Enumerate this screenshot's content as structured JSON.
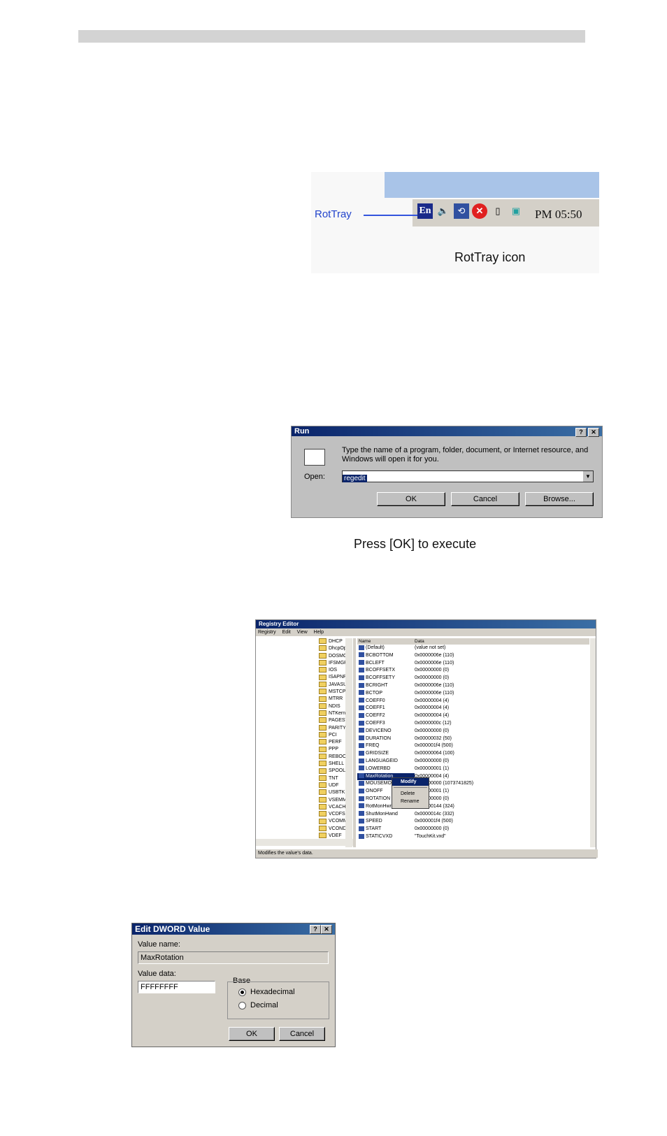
{
  "rottray": {
    "pointer_label": "RotTray",
    "tray_en": "En",
    "clock": "PM 05:50",
    "caption": "RotTray icon",
    "icons": [
      "language-en-icon",
      "speaker-icon",
      "rottray-icon",
      "close-circle-icon",
      "mouse-icon",
      "monitor-icon"
    ]
  },
  "run": {
    "title": "Run",
    "help_btn": "?",
    "close_btn": "✕",
    "prompt": "Type the name of a program, folder, document, or Internet resource, and Windows will open it for you.",
    "open_label": "Open:",
    "open_value": "regedit",
    "ok": "OK",
    "cancel": "Cancel",
    "browse": "Browse...",
    "caption": "Press [OK] to execute"
  },
  "registry": {
    "title": "Registry Editor",
    "menu": [
      "Registry",
      "Edit",
      "View",
      "Help"
    ],
    "tree": [
      "DHCP",
      "DhcpOpt",
      "DOSMGR",
      "IFSMGR",
      "IOS",
      "ISAPNP",
      "JAVASU",
      "MSTCP",
      "MTRR",
      "NDIS",
      "NTKern",
      "PAGESW",
      "PARITY",
      "PCI",
      "PERF",
      "PPP",
      "REBOOT",
      "SHELL",
      "SPOOLE",
      "TNT",
      "UDF",
      "USBTKI",
      "VSEMMG",
      "VCACHE",
      "VCDFSD",
      "VCOMM",
      "VCOND",
      "VDEF"
    ],
    "col_name": "Name",
    "col_data": "Data",
    "rows": [
      {
        "name": "(Default)",
        "data": "(value not set)"
      },
      {
        "name": "BCBOTTOM",
        "data": "0x0000006e (110)"
      },
      {
        "name": "BCLEFT",
        "data": "0x0000006e (110)"
      },
      {
        "name": "BCOFFSETX",
        "data": "0x00000000 (0)"
      },
      {
        "name": "BCOFFSETY",
        "data": "0x00000000 (0)"
      },
      {
        "name": "BCRIGHT",
        "data": "0x0000006e (110)"
      },
      {
        "name": "BCTOP",
        "data": "0x0000006e (110)"
      },
      {
        "name": "COEFF0",
        "data": "0x00000004 (4)"
      },
      {
        "name": "COEFF1",
        "data": "0x00000004 (4)"
      },
      {
        "name": "COEFF2",
        "data": "0x00000004 (4)"
      },
      {
        "name": "COEFF3",
        "data": "0x0000000c (12)"
      },
      {
        "name": "DEVICENO",
        "data": "0x00000000 (0)"
      },
      {
        "name": "DURATION",
        "data": "0x00000032 (50)"
      },
      {
        "name": "FREQ",
        "data": "0x000001f4 (500)"
      },
      {
        "name": "GRIDSIZE",
        "data": "0x00000064 (100)"
      },
      {
        "name": "LANGUAGEID",
        "data": "0x00000000 (0)"
      },
      {
        "name": "LOWERBD",
        "data": "0x00000001 (1)"
      },
      {
        "name": "MaxRotation",
        "data": "0x00000004 (4)"
      },
      {
        "name": "MOUSEMODE",
        "data": "0x00000000 (1073741825)"
      },
      {
        "name": "ONOFF",
        "data": "0x00000001 (1)"
      },
      {
        "name": "ROTATION",
        "data": "0x00000000 (0)"
      },
      {
        "name": "RotMonHwnd",
        "data": "0x00000144 (324)"
      },
      {
        "name": "ShutMonHwnd",
        "data": "0x0000014c (332)"
      },
      {
        "name": "SPEED",
        "data": "0x000001f4 (500)"
      },
      {
        "name": "START",
        "data": "0x00000000 (0)"
      },
      {
        "name": "STATICVXD",
        "data": "\"TouchKit.vxd\""
      }
    ],
    "context_menu": [
      "Modify",
      "Delete",
      "Rename"
    ],
    "status": "Modifies the value's data."
  },
  "dword": {
    "title": "Edit DWORD Value",
    "value_name_label": "Value name:",
    "value_name": "MaxRotation",
    "value_data_label": "Value data:",
    "value_data": "FFFFFFFF",
    "base_label": "Base",
    "hex": "Hexadecimal",
    "dec": "Decimal",
    "ok": "OK",
    "cancel": "Cancel"
  }
}
